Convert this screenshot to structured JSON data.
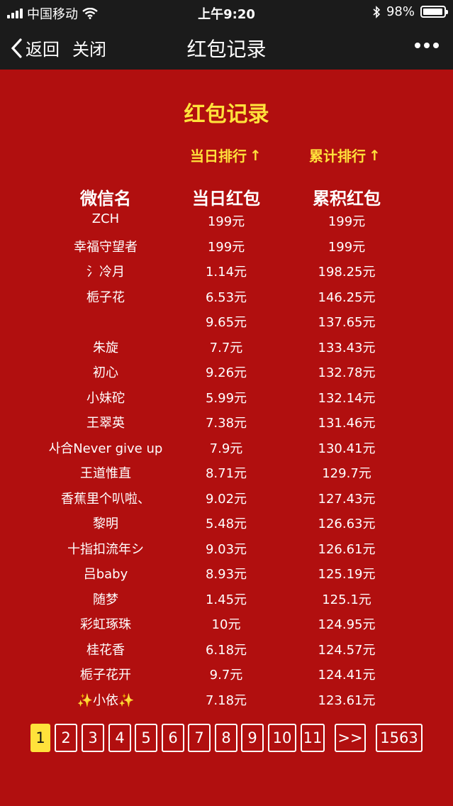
{
  "status_bar": {
    "carrier": "中国移动",
    "time": "上午9:20",
    "battery": "98%"
  },
  "nav": {
    "back_label": "返回",
    "close_label": "关闭",
    "title": "红包记录"
  },
  "page": {
    "title": "红包记录",
    "sort_day_label": "当日排行",
    "sort_total_label": "累计排行",
    "sort_arrow": "↑",
    "columns": [
      "微信名",
      "当日红包",
      "累积红包"
    ]
  },
  "rows": [
    {
      "name": "ZCH",
      "day": "199元",
      "total": "199元"
    },
    {
      "name": "幸福守望者",
      "day": "199元",
      "total": "199元"
    },
    {
      "name": "氵冷月",
      "day": "1.14元",
      "total": "198.25元"
    },
    {
      "name": "栀子花",
      "day": "6.53元",
      "total": "146.25元"
    },
    {
      "name": "",
      "day": "9.65元",
      "total": "137.65元"
    },
    {
      "name": "朱旋",
      "day": "7.7元",
      "total": "133.43元"
    },
    {
      "name": "初心",
      "day": "9.26元",
      "total": "132.78元"
    },
    {
      "name": "小妹砣",
      "day": "5.99元",
      "total": "132.14元"
    },
    {
      "name": "王翠英",
      "day": "7.38元",
      "total": "131.46元"
    },
    {
      "name": "사合Never give up",
      "day": "7.9元",
      "total": "130.41元"
    },
    {
      "name": "王道惟直",
      "day": "8.71元",
      "total": "129.7元"
    },
    {
      "name": "香蕉里个叭啦、",
      "day": "9.02元",
      "total": "127.43元"
    },
    {
      "name": "黎明",
      "day": "5.48元",
      "total": "126.63元"
    },
    {
      "name": "十指扣流年シ",
      "day": "9.03元",
      "total": "126.61元"
    },
    {
      "name": "吕baby",
      "day": "8.93元",
      "total": "125.19元"
    },
    {
      "name": "随梦",
      "day": "1.45元",
      "total": "125.1元"
    },
    {
      "name": "彩虹琢珠",
      "day": "10元",
      "total": "124.95元"
    },
    {
      "name": "桂花香",
      "day": "6.18元",
      "total": "124.57元"
    },
    {
      "name": "栀子花开",
      "day": "9.7元",
      "total": "124.41元"
    },
    {
      "name": "✨小依✨",
      "day": "7.18元",
      "total": "123.61元"
    }
  ],
  "pagination": {
    "current": "1",
    "pages": [
      "1",
      "2",
      "3",
      "4",
      "5",
      "6",
      "7",
      "8",
      "9",
      "10",
      "11"
    ],
    "next_label": ">>",
    "last_label": "1563"
  },
  "colors": {
    "background": "#b10f0f",
    "accent": "#ffe23b",
    "bar": "#1b1b1b"
  },
  "icons": [
    "signal-icon",
    "wifi-icon",
    "bluetooth-icon",
    "battery-icon",
    "chevron-left-icon",
    "more-icon",
    "arrow-up-icon"
  ]
}
